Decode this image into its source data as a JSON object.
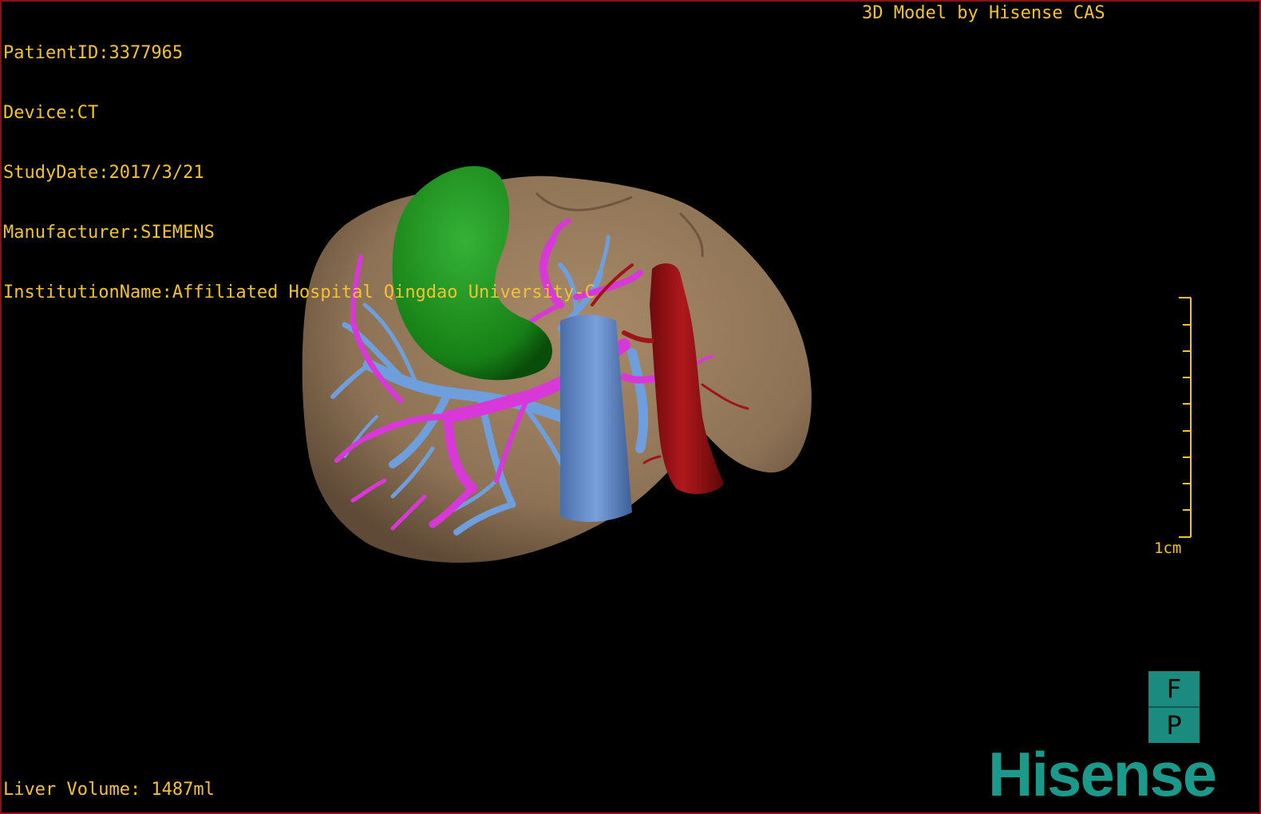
{
  "header": {
    "lines": [
      "PatientID:3377965",
      "Device:CT",
      "StudyDate:2017/3/21",
      "Manufacturer:SIEMENS",
      "InstitutionName:Affiliated Hospital Qingdao University-C"
    ],
    "credit": "3D Model by Hisense CAS"
  },
  "footer": {
    "volume": "Liver Volume: 1487ml"
  },
  "scale": {
    "label": "1cm"
  },
  "orientation": {
    "top": "F",
    "bottom": "P"
  },
  "brand": {
    "logo_text": "Hisense"
  },
  "colors": {
    "overlay_text": "#f2c233",
    "liver": "#8d7255",
    "gallbladder": "#1a8c1a",
    "portal_vein": "#d838d8",
    "hepatic_vein": "#6f9edc",
    "artery": "#a01418",
    "vena_cava": "#5e86c4",
    "brand": "#1b9a8c"
  }
}
